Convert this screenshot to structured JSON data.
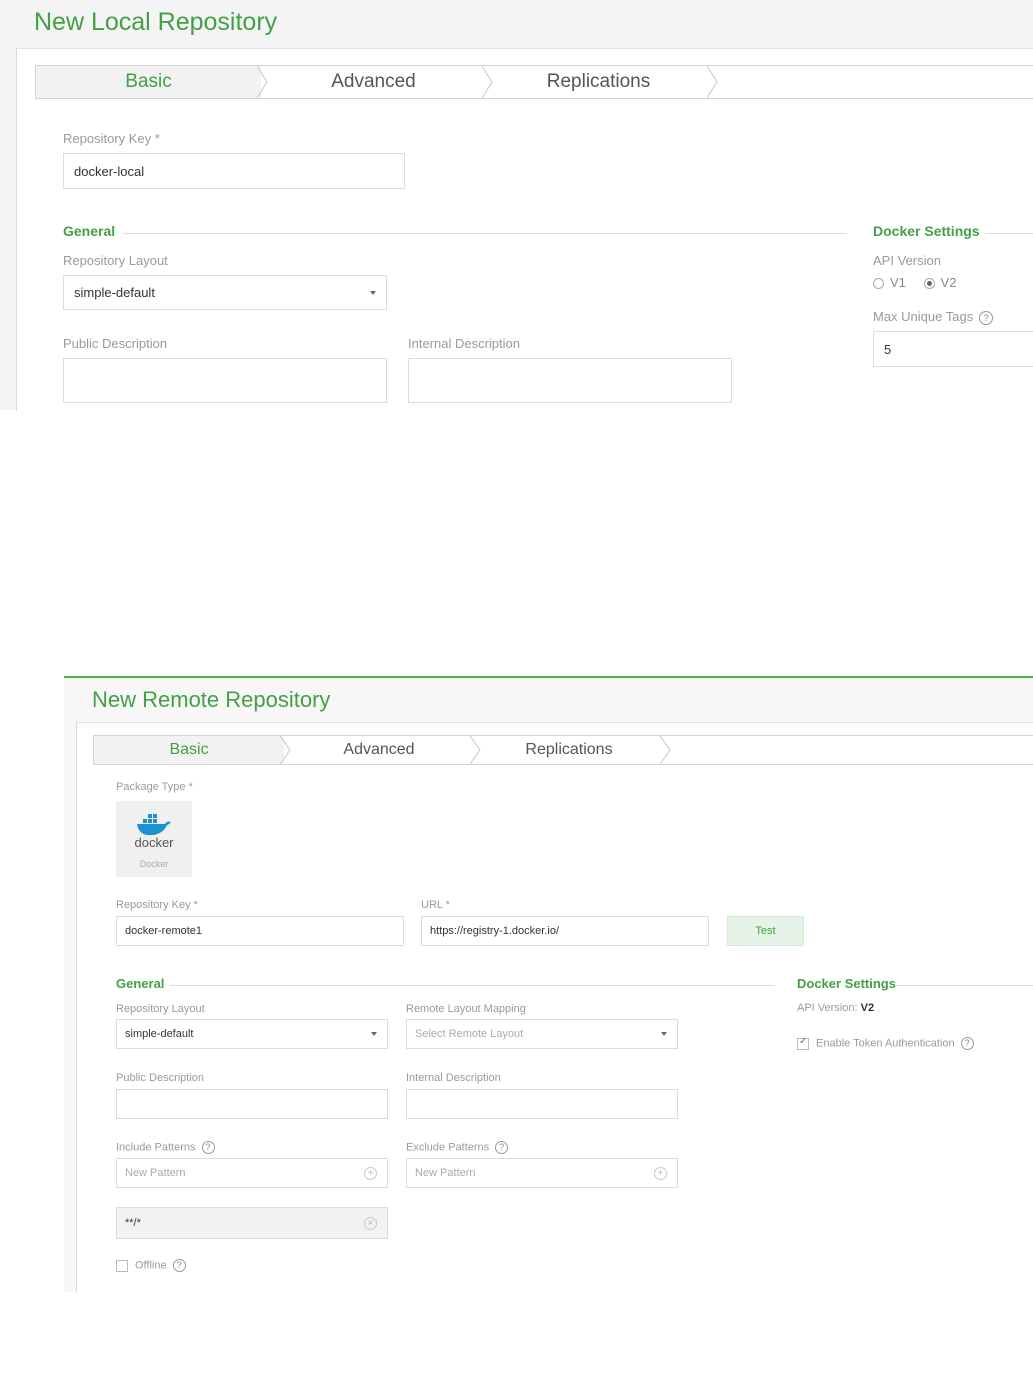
{
  "local": {
    "title": "New Local Repository",
    "tabs": [
      {
        "label": "Basic"
      },
      {
        "label": "Advanced"
      },
      {
        "label": "Replications"
      }
    ],
    "repository_key": {
      "label": "Repository Key *",
      "value": "docker-local"
    },
    "general": {
      "heading": "General",
      "layout": {
        "label": "Repository Layout",
        "value": "simple-default"
      },
      "public_description": {
        "label": "Public Description",
        "value": ""
      },
      "internal_description": {
        "label": "Internal Description",
        "value": ""
      }
    },
    "docker_settings": {
      "heading": "Docker Settings",
      "api_version_label": "API Version",
      "api_options": [
        {
          "label": "V1",
          "selected": false
        },
        {
          "label": "V2",
          "selected": true
        }
      ],
      "max_unique_tags": {
        "label": "Max Unique Tags",
        "value": "5",
        "help": "?"
      }
    }
  },
  "remote": {
    "title": "New Remote Repository",
    "tabs": [
      {
        "label": "Basic"
      },
      {
        "label": "Advanced"
      },
      {
        "label": "Replications"
      }
    ],
    "package_type": {
      "label": "Package Type *",
      "icon": "docker-whale-icon",
      "logo_text": "docker",
      "name": "Docker"
    },
    "repository_key": {
      "label": "Repository Key *",
      "value": "docker-remote1"
    },
    "url": {
      "label": "URL *",
      "value": "https://registry-1.docker.io/"
    },
    "test_button": "Test",
    "general": {
      "heading": "General",
      "layout": {
        "label": "Repository Layout",
        "value": "simple-default"
      },
      "remote_layout_mapping": {
        "label": "Remote Layout Mapping",
        "placeholder": "Select Remote Layout"
      },
      "public_description": {
        "label": "Public Description",
        "value": ""
      },
      "internal_description": {
        "label": "Internal Description",
        "value": ""
      },
      "include_patterns": {
        "label": "Include Patterns",
        "placeholder": "New Pattern",
        "items": [
          "**/*"
        ]
      },
      "exclude_patterns": {
        "label": "Exclude Patterns",
        "placeholder": "New Pattern"
      },
      "offline": {
        "label": "Offline",
        "checked": false
      }
    },
    "docker_settings": {
      "heading": "Docker Settings",
      "api_version_label": "API Version:",
      "api_version_value": "V2",
      "token_auth": {
        "label": "Enable Token Authentication",
        "checked": true
      }
    },
    "colors": {
      "accent": "#43a047",
      "header_rule": "#4caf50"
    }
  }
}
